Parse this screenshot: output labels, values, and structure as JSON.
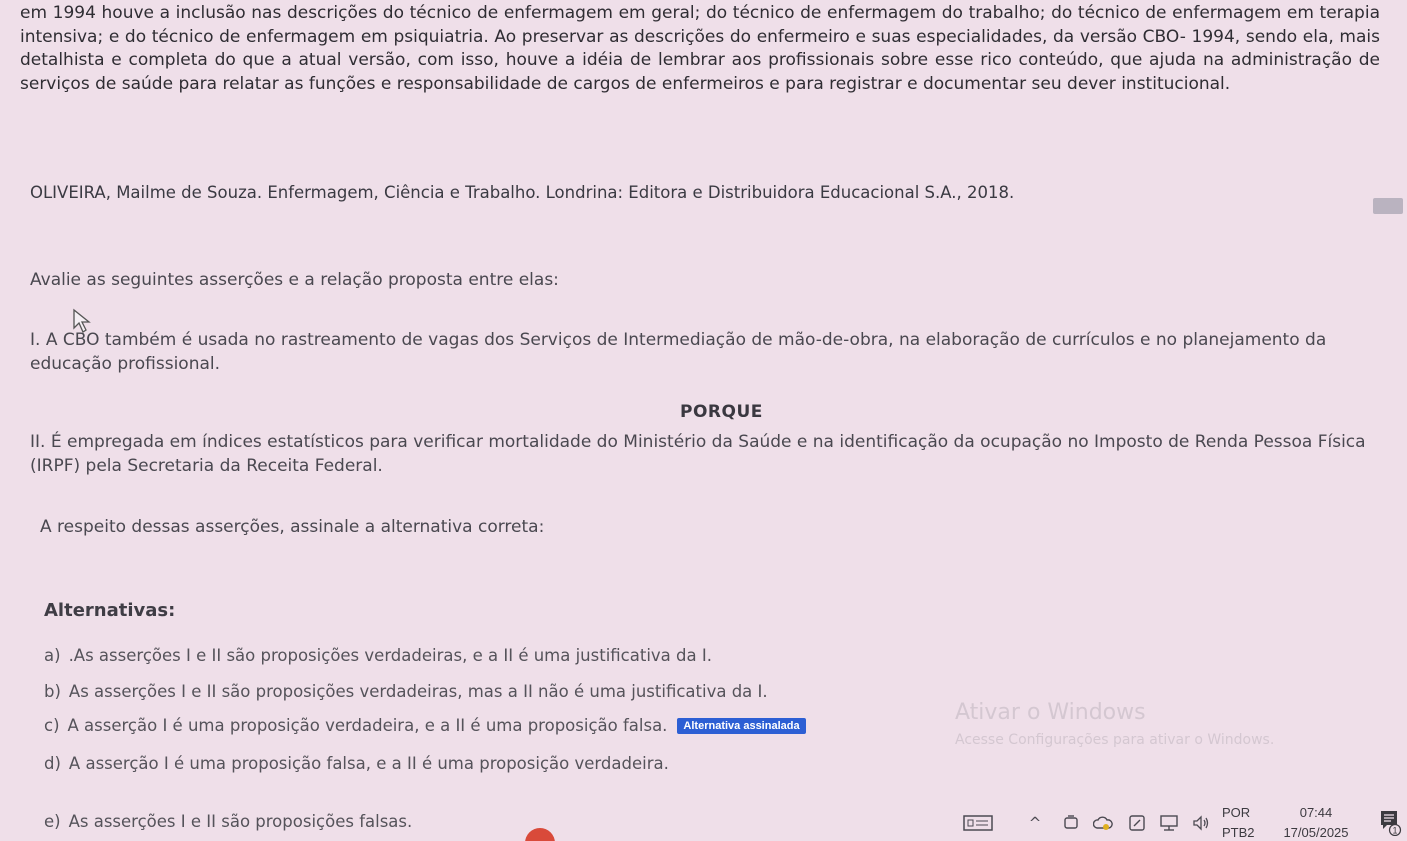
{
  "intro_text": "em 1994 houve a inclusão nas descrições do técnico de enfermagem em geral; do técnico de enfermagem do trabalho; do técnico de enfermagem em terapia intensiva; e do técnico de enfermagem em psiquiatria. Ao preservar as descrições do enfermeiro e suas especialidades, da versão CBO- 1994, sendo ela, mais detalhista e completa do que a atual versão, com isso, houve a idéia de lembrar aos profissionais sobre esse rico conteúdo, que ajuda na administração de serviços de saúde para relatar as funções e responsabilidade de cargos de enfermeiros e para registrar e documentar seu dever institucional.",
  "reference": "OLIVEIRA, Mailme de Souza. Enfermagem, Ciência e Trabalho. Londrina: Editora e Distribuidora Educacional S.A., 2018.",
  "prompt": "Avalie as seguintes asserções e a relação proposta entre elas:",
  "assertion_1": "I. A CBO também é usada no rastreamento de vagas dos Serviços de Intermediação de mão-de-obra, na elaboração de currículos e no planejamento da educação profissional.",
  "porque": "PORQUE",
  "assertion_2": "II. É empregada em índices estatísticos para verificar mortalidade do Ministério da Saúde e na identificação da ocupação no Imposto de Renda Pessoa Física (IRPF) pela Secretaria da Receita Federal.",
  "question": "A respeito dessas asserções, assinale a alternativa correta:",
  "alternatives_title": "Alternativas:",
  "alternatives": [
    {
      "letter": "a)",
      "text": ".As asserções I e II são proposições verdadeiras, e a II é uma justificativa da I."
    },
    {
      "letter": "b)",
      "text": "As asserções I e II são proposições verdadeiras, mas a II não é uma justificativa da I."
    },
    {
      "letter": "c)",
      "text": "A asserção I é uma proposição verdadeira, e a II é uma proposição falsa.",
      "badge": "Alternativa assinalada"
    },
    {
      "letter": "d)",
      "text": "A asserção I é uma proposição falsa, e a II é uma proposição verdadeira."
    },
    {
      "letter": "e)",
      "text": "As asserções I e II são proposições falsas."
    }
  ],
  "watermark": {
    "title": "Ativar o Windows",
    "subtitle": "Acesse Configurações para ativar o Windows."
  },
  "taskbar": {
    "lang_top": "POR",
    "lang_bottom": "PTB2",
    "time": "07:44",
    "date": "17/05/2025",
    "notification_count": "1"
  },
  "colors": {
    "background": "#efdfe9",
    "badge": "#2c5fd4"
  }
}
